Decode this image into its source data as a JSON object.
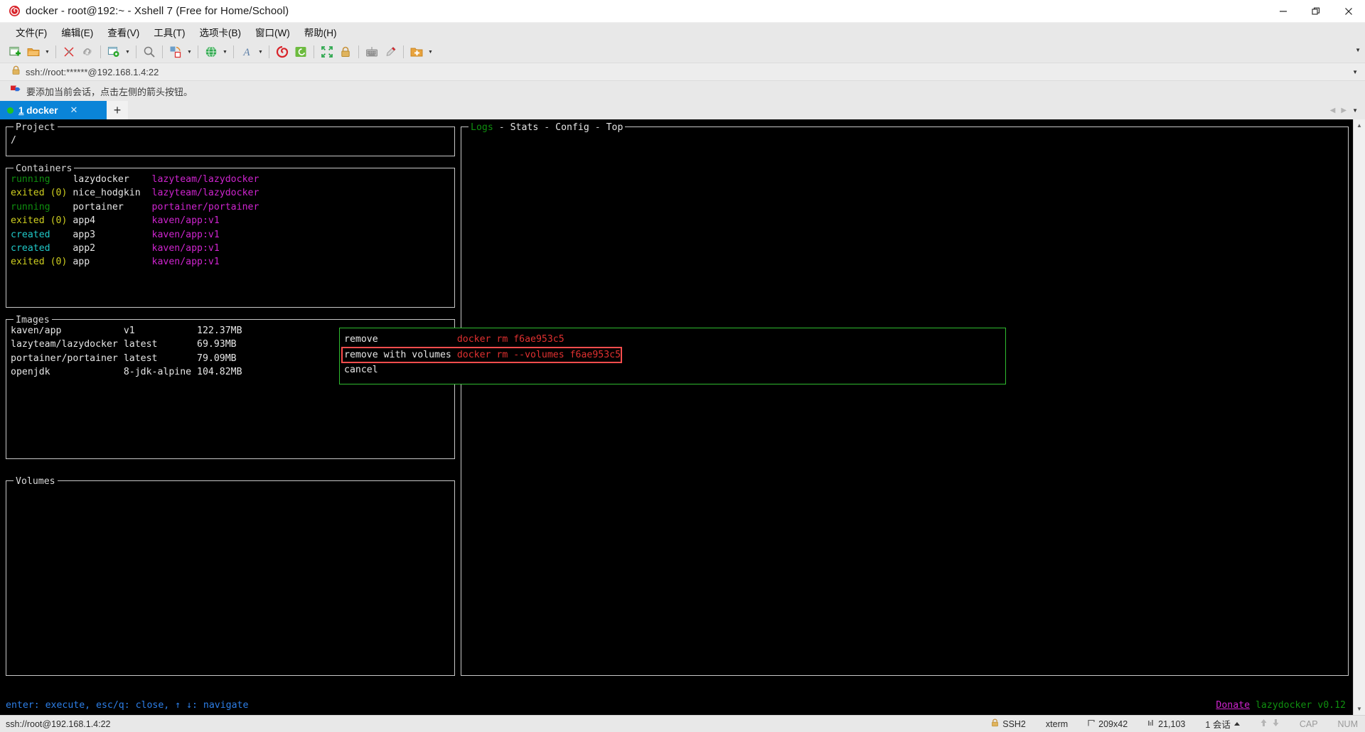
{
  "window": {
    "title": "docker - root@192:~ - Xshell 7 (Free for Home/School)",
    "app_icon": "xshell-logo-icon",
    "minimize": "—",
    "maximize": "❐",
    "close": "✕"
  },
  "menubar": {
    "items": [
      {
        "label": "文件(F)",
        "name": "menu-file"
      },
      {
        "label": "编辑(E)",
        "name": "menu-edit"
      },
      {
        "label": "查看(V)",
        "name": "menu-view"
      },
      {
        "label": "工具(T)",
        "name": "menu-tools"
      },
      {
        "label": "选项卡(B)",
        "name": "menu-tabs"
      },
      {
        "label": "窗口(W)",
        "name": "menu-window"
      },
      {
        "label": "帮助(H)",
        "name": "menu-help"
      }
    ]
  },
  "toolbar": {
    "overflow_caret": "▼",
    "buttons": [
      {
        "name": "new-session-icon",
        "glyph": "➕"
      },
      {
        "name": "open-folder-icon",
        "glyph": "📁",
        "caret": true
      },
      {
        "name": "disconnect-icon",
        "glyph": "✂"
      },
      {
        "name": "reconnect-icon",
        "glyph": "🔗"
      },
      {
        "name": "session-properties-icon",
        "glyph": "⚙",
        "caret": true
      },
      {
        "name": "find-icon",
        "glyph": "🔍"
      },
      {
        "name": "transfer-icon",
        "glyph": "⇄",
        "caret": true
      },
      {
        "name": "web-browser-icon",
        "glyph": "🌐",
        "caret": true
      },
      {
        "name": "font-icon",
        "glyph": "A",
        "caret": true
      },
      {
        "name": "xshell-icon",
        "glyph": "◔"
      },
      {
        "name": "xftp-icon",
        "glyph": "◰"
      },
      {
        "name": "fullscreen-icon",
        "glyph": "⤢"
      },
      {
        "name": "lock-icon",
        "glyph": "🔒"
      },
      {
        "name": "keyboard-icon",
        "glyph": "⌨"
      },
      {
        "name": "highlight-icon",
        "glyph": "✎"
      },
      {
        "name": "add-folder-icon",
        "glyph": "🗁",
        "caret": true
      }
    ]
  },
  "address_bar": {
    "lock_icon": "lock-icon",
    "value": "ssh://root:******@192.168.1.4:22",
    "caret": "▼"
  },
  "notice_bar": {
    "icon": "flag-icon",
    "text": "要添加当前会话，点击左侧的箭头按钮。"
  },
  "tabbar": {
    "tabs": [
      {
        "name": "tab-docker",
        "index": "1",
        "label": " docker",
        "status_dot_color": "#21c421",
        "close": "✕"
      }
    ],
    "new_tab": "+",
    "nav_prev": "◀",
    "nav_next": "▶",
    "nav_menu": "▼"
  },
  "terminal": {
    "project": {
      "title": "Project",
      "path": "/"
    },
    "containers": {
      "title": "Containers",
      "rows": [
        {
          "state": "running",
          "code": "   ",
          "name": "lazydocker  ",
          "image": "lazyteam/lazydocker",
          "state_color": "green"
        },
        {
          "state": "exited ",
          "code": "(0)",
          "name": "nice_hodgkin",
          "image": "lazyteam/lazydocker",
          "state_color": "yellow"
        },
        {
          "state": "running",
          "code": "   ",
          "name": "portainer   ",
          "image": "portainer/portainer",
          "state_color": "green"
        },
        {
          "state": "exited ",
          "code": "(0)",
          "name": "app4        ",
          "image": "kaven/app:v1",
          "state_color": "yellow"
        },
        {
          "state": "created",
          "code": "   ",
          "name": "app3        ",
          "image": "kaven/app:v1",
          "state_color": "cyan"
        },
        {
          "state": "created",
          "code": "   ",
          "name": "app2        ",
          "image": "kaven/app:v1",
          "state_color": "cyan"
        },
        {
          "state": "exited ",
          "code": "(0)",
          "name": "app         ",
          "image": "kaven/app:v1",
          "state_color": "yellow"
        }
      ]
    },
    "images": {
      "title": "Images",
      "rows": [
        {
          "repo": "kaven/app          ",
          "tag": "v1           ",
          "size": "122.37MB"
        },
        {
          "repo": "lazyteam/lazydocker",
          "tag": "latest       ",
          "size": "69.93MB"
        },
        {
          "repo": "portainer/portainer",
          "tag": "latest       ",
          "size": "79.09MB"
        },
        {
          "repo": "openjdk            ",
          "tag": "8-jdk-alpine ",
          "size": "104.82MB"
        }
      ]
    },
    "volumes": {
      "title": "Volumes"
    },
    "main_panel": {
      "tabs": [
        {
          "label": "Logs",
          "active": true
        },
        {
          "label": "Stats",
          "active": false
        },
        {
          "label": "Config",
          "active": false
        },
        {
          "label": "Top",
          "active": false
        }
      ],
      "separator": " - "
    },
    "popup": {
      "options": [
        {
          "label": "remove             ",
          "command": "docker rm f6ae953c5",
          "selected": false
        },
        {
          "label": "remove with volumes",
          "command": "docker rm --volumes f6ae953c5",
          "selected": true
        },
        {
          "label": "cancel             ",
          "command": "",
          "selected": false
        }
      ]
    },
    "footer_left": "enter: execute, esc/q: close, ↑ ↓: navigate",
    "footer_right_donate": "Donate",
    "footer_right_version": " lazydocker v0.12"
  },
  "statusbar": {
    "connection": "ssh://root@192.168.1.4:22",
    "protocol": "SSH2",
    "protocol_icon": "lock-icon",
    "terminal_type": "xterm",
    "size_icon": "resize-icon",
    "size": "209x42",
    "bytes_icon": "transfer-icon",
    "bytes": "21,103",
    "sessions": "1 会话",
    "sessions_caret": "▲",
    "upload_icon": "⬆",
    "download_icon": "⬇",
    "cap": "CAP",
    "num": "NUM"
  },
  "colors": {
    "accent_blue": "#0a84d8",
    "terminal_bg": "#000000",
    "green": "#2fbb2f",
    "yellow": "#cfcf20",
    "cyan": "#20c9c9",
    "magenta": "#cf24cf",
    "red": "#e03030",
    "blue_text": "#2d7fe8"
  }
}
